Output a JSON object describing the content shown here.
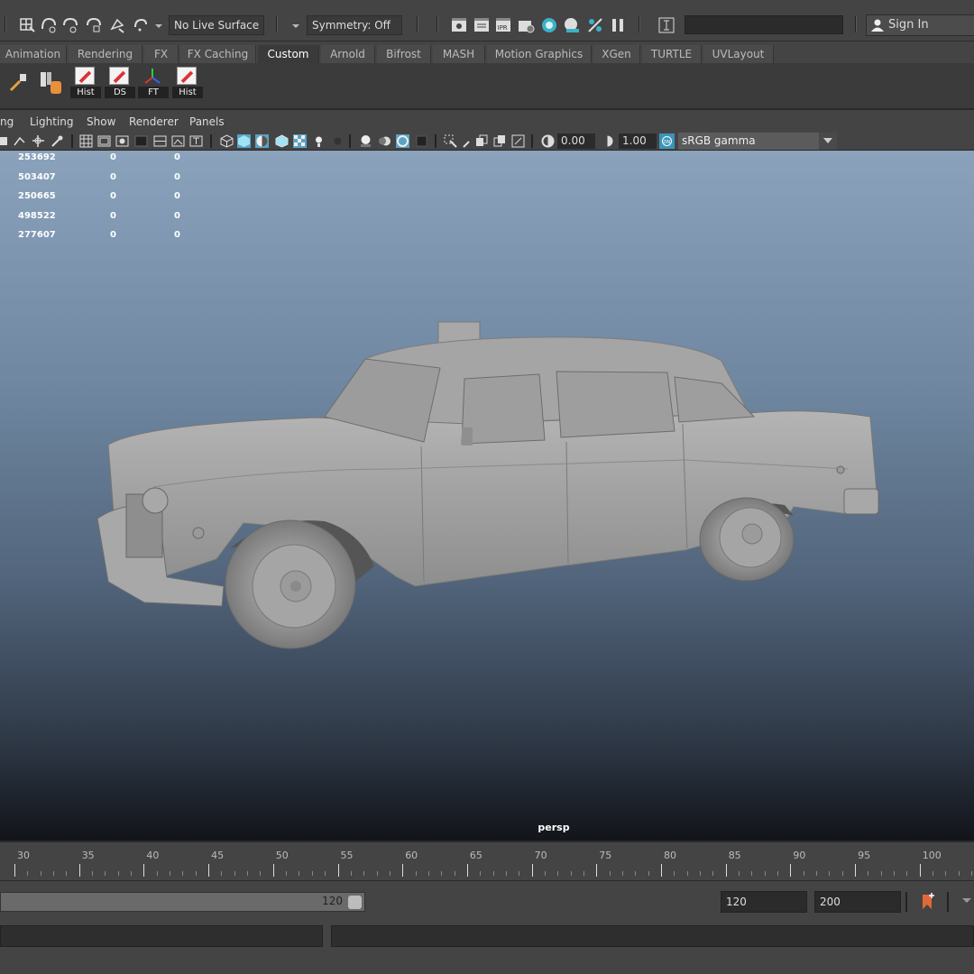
{
  "toolbar": {
    "live_surface": "No Live Surface",
    "symmetry": "Symmetry: Off",
    "sign_in": "Sign In"
  },
  "shelf_tabs": [
    "Animation",
    "Rendering",
    "FX",
    "FX Caching",
    "Custom",
    "Arnold",
    "Bifrost",
    "MASH",
    "Motion Graphics",
    "XGen",
    "TURTLE",
    "UVLayout"
  ],
  "active_shelf_tab": "Custom",
  "shelf_buttons": [
    "Hist",
    "DS",
    "FT",
    "Hist"
  ],
  "panel_menu": [
    "ng",
    "Lighting",
    "Show",
    "Renderer",
    "Panels"
  ],
  "panel_toolbar": {
    "exposure": "0.00",
    "gamma": "1.00",
    "color_space": "sRGB gamma"
  },
  "hud_stats": [
    {
      "value": "253692",
      "a": "0",
      "b": "0"
    },
    {
      "value": "503407",
      "a": "0",
      "b": "0"
    },
    {
      "value": "250665",
      "a": "0",
      "b": "0"
    },
    {
      "value": "498522",
      "a": "0",
      "b": "0"
    },
    {
      "value": "277607",
      "a": "0",
      "b": "0"
    }
  ],
  "camera_label": "persp",
  "timeline": {
    "ticks": [
      "30",
      "35",
      "40",
      "45",
      "50",
      "55",
      "60",
      "65",
      "70",
      "75",
      "80",
      "85",
      "90",
      "95",
      "100"
    ]
  },
  "range": {
    "slider_end": "120",
    "end_time": "120",
    "anim_end": "200"
  }
}
